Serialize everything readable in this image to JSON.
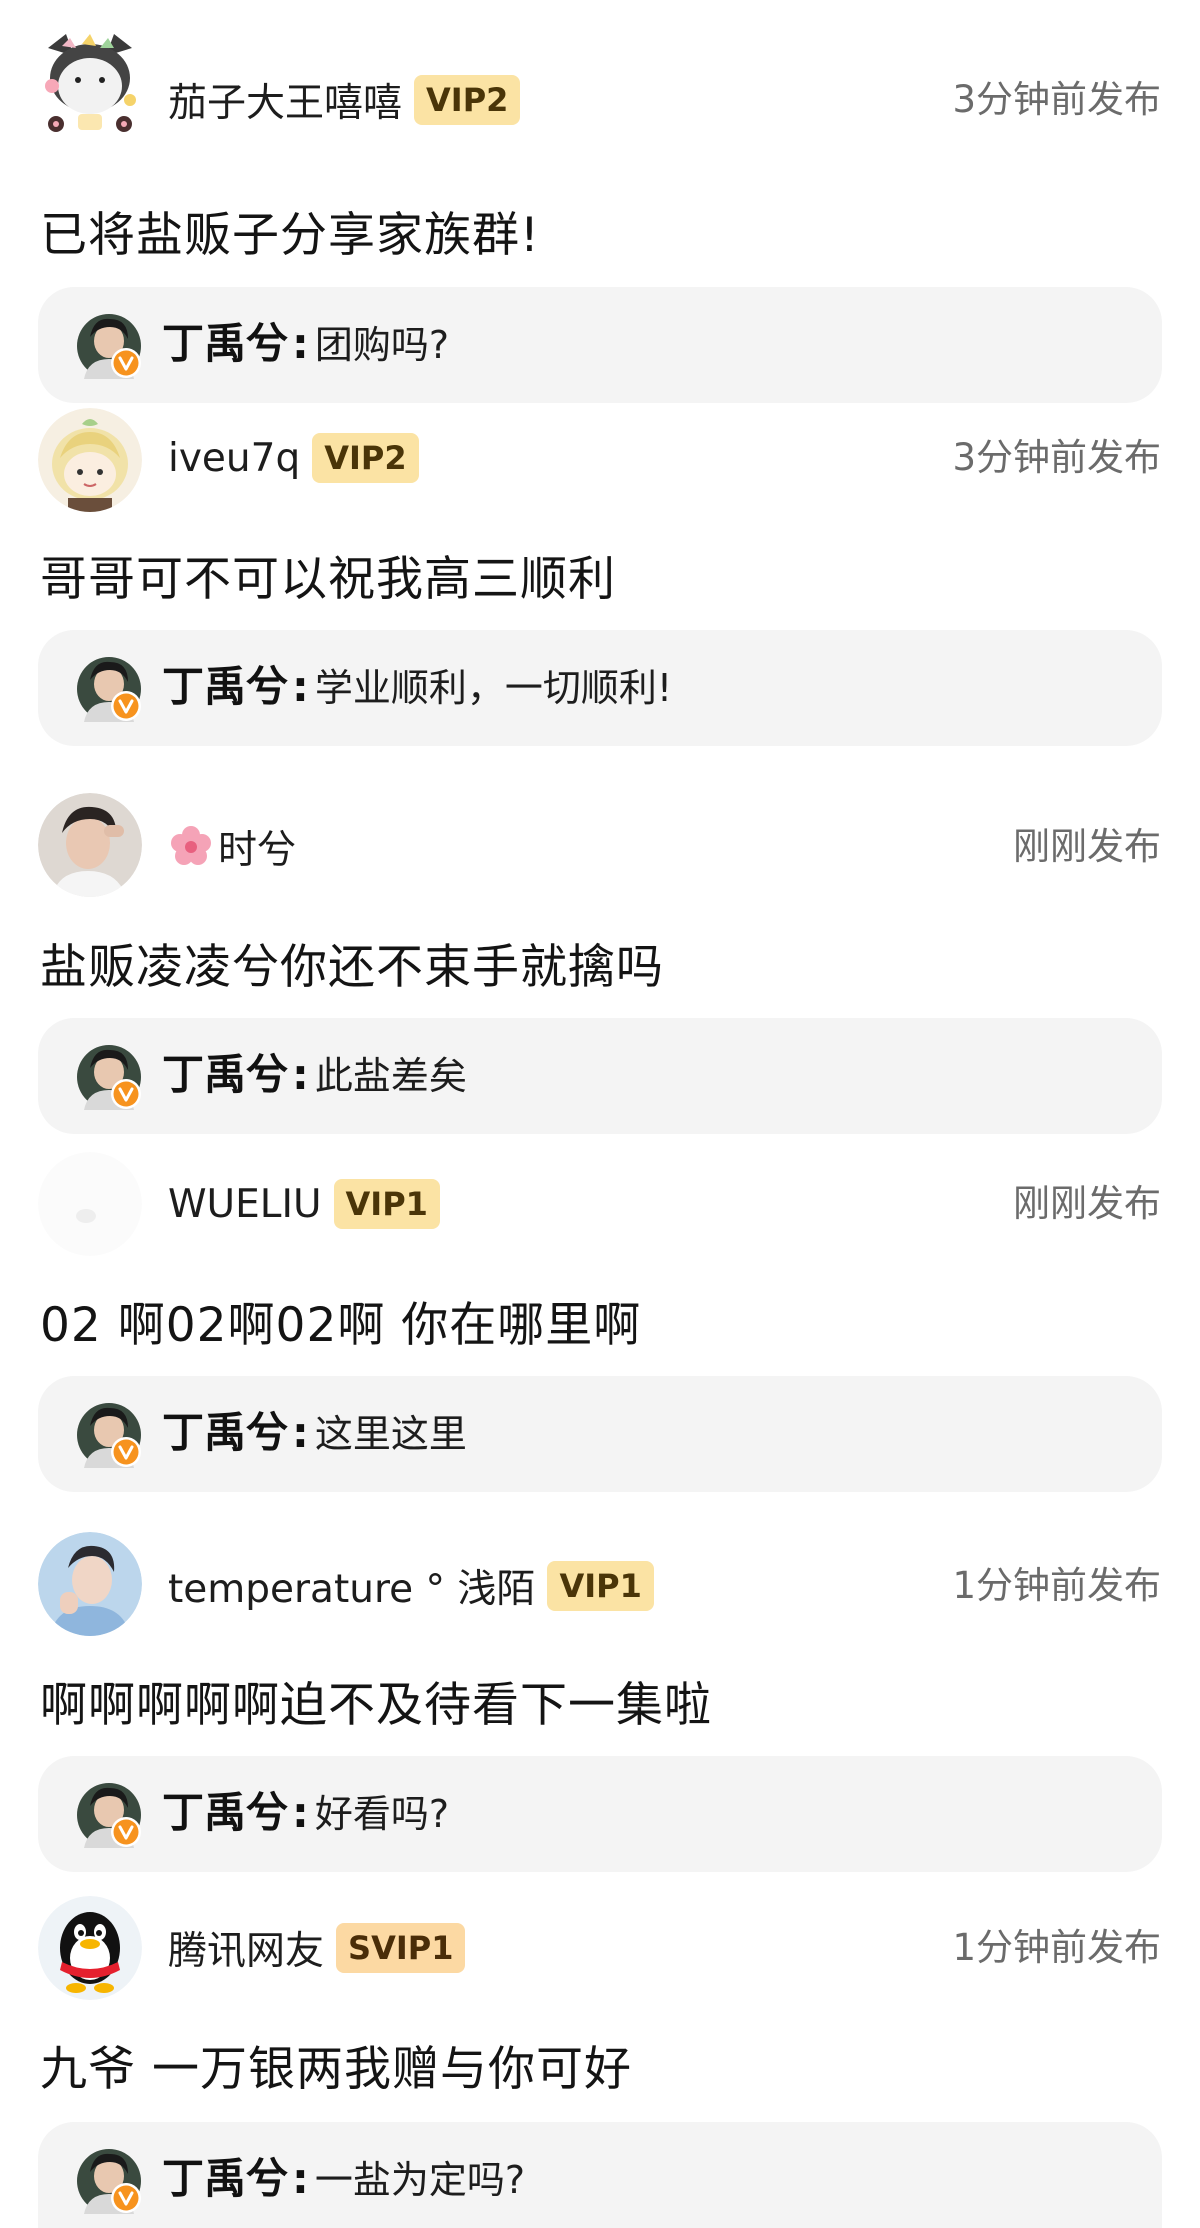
{
  "reply_author": "丁禹兮",
  "reply_separator": ":",
  "comments": [
    {
      "username": "茄子大王嘻嘻",
      "badge": "VIP2",
      "timestamp": "3分钟前发布",
      "text": "已将盐贩子分享家族群!",
      "reply": "团购吗?"
    },
    {
      "username": "iveu7q",
      "badge": "VIP2",
      "timestamp": "3分钟前发布",
      "text": "哥哥可不可以祝我高三顺利",
      "reply": "学业顺利，一切顺利!"
    },
    {
      "username": "时兮",
      "badge": "",
      "timestamp": "刚刚发布",
      "text": "盐贩凌凌兮你还不束手就擒吗",
      "reply": "此盐差矣"
    },
    {
      "username": "WUELIU",
      "badge": "VIP1",
      "timestamp": "刚刚发布",
      "text": "02 啊02啊02啊 你在哪里啊",
      "reply": "这里这里"
    },
    {
      "username": "temperature ° 浅陌",
      "badge": "VIP1",
      "timestamp": "1分钟前发布",
      "text": "啊啊啊啊啊迫不及待看下一集啦",
      "reply": "好看吗?"
    },
    {
      "username": "腾讯网友",
      "badge": "SVIP1",
      "timestamp": "1分钟前发布",
      "text": "九爷 一万银两我赠与你可好",
      "reply": "一盐为定吗?"
    }
  ],
  "colors": {
    "vip_badge": "#fbe3a4",
    "svip_badge": "#fcd9a3",
    "reply_bg": "#f4f4f4",
    "verified": "#f7931e"
  }
}
